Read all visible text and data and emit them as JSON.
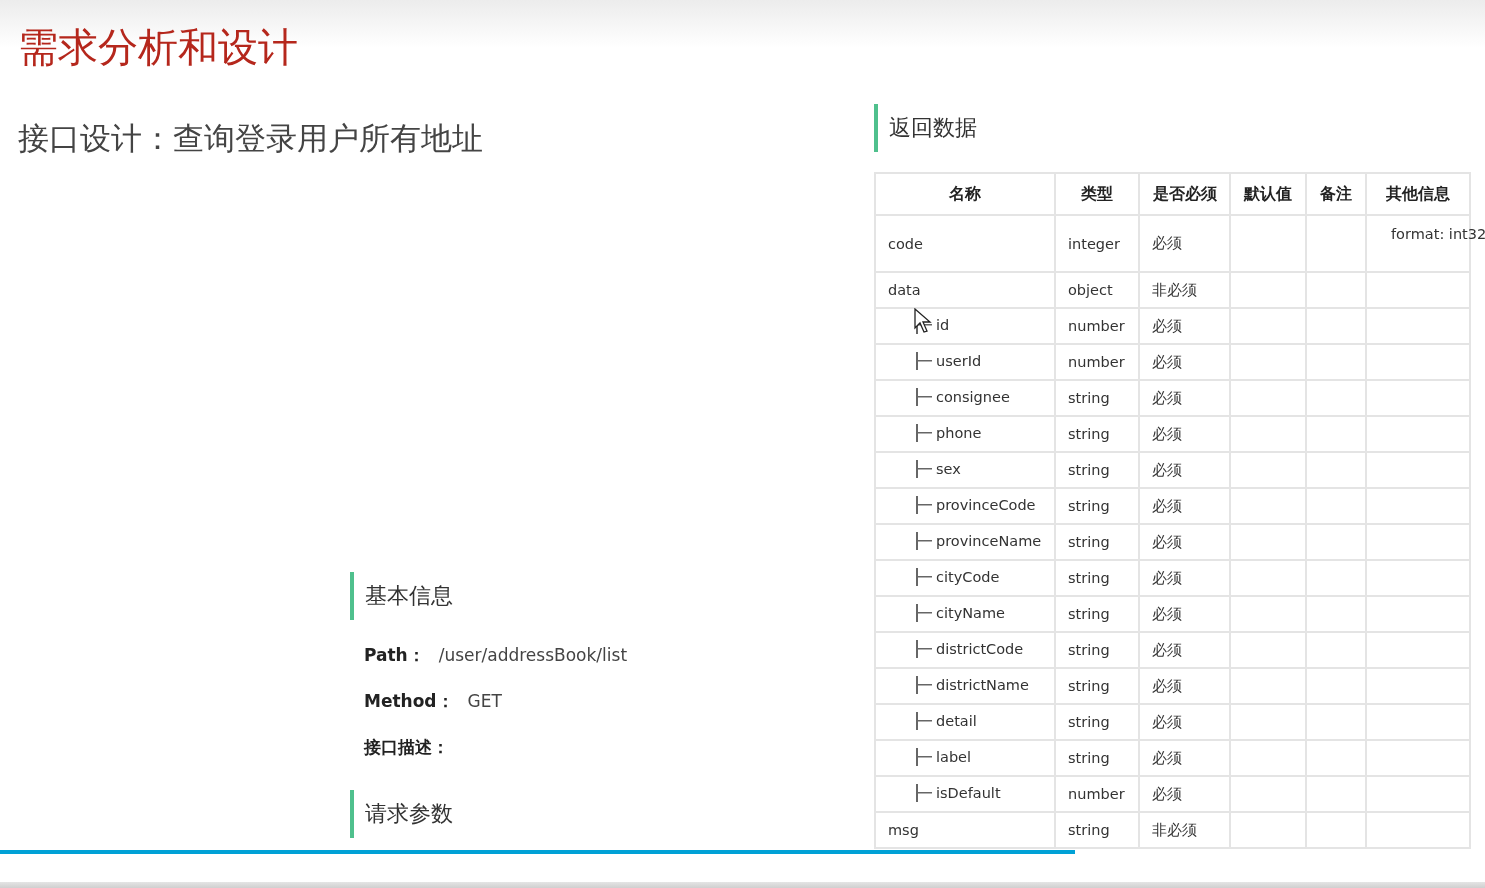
{
  "slide": {
    "title": "需求分析和设计",
    "subtitle": "接口设计：查询登录用户所有地址",
    "basic": {
      "heading": "基本信息",
      "fields": [
        {
          "label": "Path：",
          "value": "/user/addressBook/list"
        },
        {
          "label": "Method：",
          "value": "GET"
        },
        {
          "label": "接口描述："
        }
      ]
    },
    "request_heading": "请求参数",
    "response": {
      "heading": "返回数据",
      "columns": [
        "名称",
        "类型",
        "是否必须",
        "默认值",
        "备注",
        "其他信息"
      ],
      "rows": [
        {
          "name": "code",
          "type": "integer",
          "required": "必须",
          "other": "format: int32"
        },
        {
          "name": "data",
          "type": "object",
          "required": "非必须",
          "children": [
            {
              "name": "id",
              "type": "number",
              "required": "必须"
            },
            {
              "name": "userId",
              "type": "number",
              "required": "必须"
            },
            {
              "name": "consignee",
              "type": "string",
              "required": "必须"
            },
            {
              "name": "phone",
              "type": "string",
              "required": "必须"
            },
            {
              "name": "sex",
              "type": "string",
              "required": "必须"
            },
            {
              "name": "provinceCode",
              "type": "string",
              "required": "必须"
            },
            {
              "name": "provinceName",
              "type": "string",
              "required": "必须"
            },
            {
              "name": "cityCode",
              "type": "string",
              "required": "必须"
            },
            {
              "name": "cityName",
              "type": "string",
              "required": "必须"
            },
            {
              "name": "districtCode",
              "type": "string",
              "required": "必须"
            },
            {
              "name": "districtName",
              "type": "string",
              "required": "必须"
            },
            {
              "name": "detail",
              "type": "string",
              "required": "必须"
            },
            {
              "name": "label",
              "type": "string",
              "required": "必须"
            },
            {
              "name": "isDefault",
              "type": "number",
              "required": "必须"
            }
          ]
        },
        {
          "name": "msg",
          "type": "string",
          "required": "非必须"
        }
      ]
    }
  },
  "player": {
    "progress": {
      "level": 0.724
    }
  }
}
